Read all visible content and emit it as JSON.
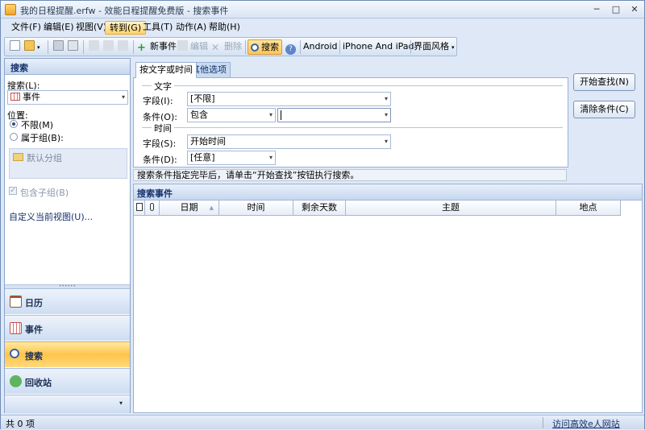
{
  "window": {
    "title": "我的日程提醒.erfw - 效能日程提醒免费版 - 搜索事件",
    "minimize": "─",
    "maximize": "□",
    "close": "✕"
  },
  "menu": [
    "文件(F)",
    "编辑(E)",
    "视图(V)",
    "转到(G)",
    "工具(T)",
    "动作(A)",
    "帮助(H)"
  ],
  "toolbar": {
    "new_event": "新事件",
    "edit": "编辑",
    "delete": "删除",
    "search": "搜索",
    "android": "Android",
    "iphone": "iPhone And iPad",
    "theme": "界面风格"
  },
  "left": {
    "title": "搜索",
    "search_label": "搜索(L):",
    "search_value": "事件",
    "location_label": "位置:",
    "radio_unlimited": "不限(M)",
    "radio_group": "属于组(B):",
    "default_group": "默认分组",
    "include_sub": "包含子组(B)",
    "custom_view": "自定义当前视图(U)...",
    "nav": [
      "日历",
      "事件",
      "搜索",
      "回收站"
    ]
  },
  "tabs": [
    "按文字或时间",
    "其他选项"
  ],
  "criteria": {
    "text_section": "文字",
    "field_label": "字段(I):",
    "field_value": "[不限]",
    "cond_label": "条件(O):",
    "cond_value": "包含",
    "cond_text": "",
    "time_section": "时间",
    "time_field_label": "字段(S):",
    "time_field_value": "开始时间",
    "time_cond_label": "条件(D):",
    "time_cond_value": "[任意]"
  },
  "buttons": {
    "start": "开始查找(N)",
    "clear": "清除条件(C)"
  },
  "status_message": "搜索条件指定完毕后，请单击“开始查找”按钮执行搜索。",
  "results": {
    "title": "搜索事件",
    "columns": [
      "日期",
      "时间",
      "剩余天数",
      "主题",
      "地点"
    ]
  },
  "statusbar": {
    "count": "共 0 项",
    "link": "访问高效e人网站"
  }
}
